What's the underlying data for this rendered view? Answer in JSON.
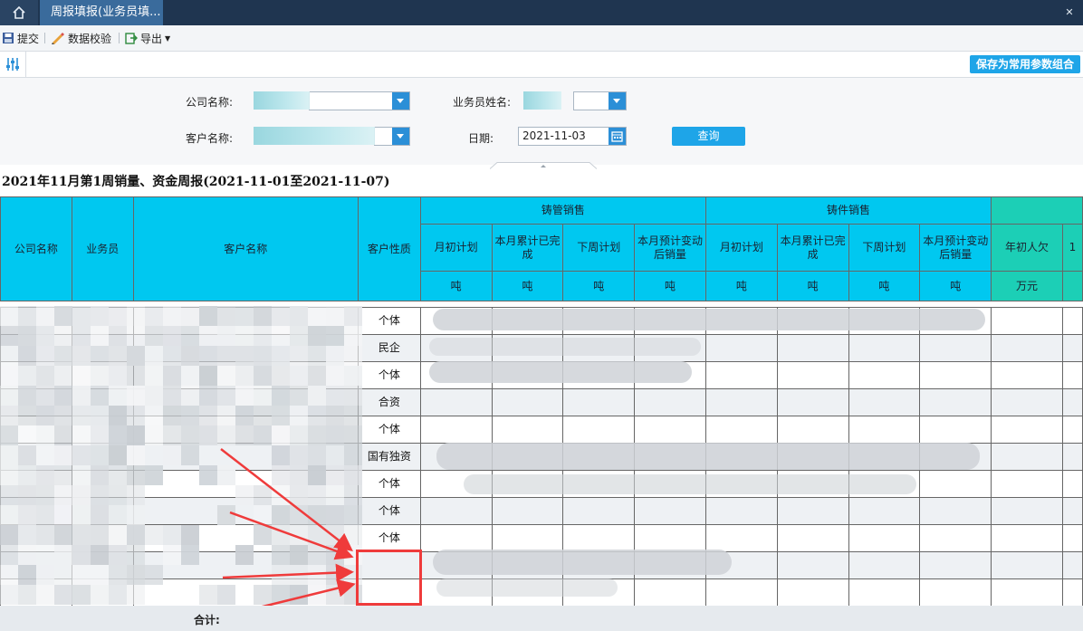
{
  "tabs": {
    "active_label": "周报填报(业务员填..."
  },
  "toolbar": {
    "submit": "提交",
    "validate": "数据校验",
    "export": "导出"
  },
  "actions": {
    "save_params": "保存为常用参数组合",
    "query": "查询"
  },
  "form": {
    "company_label": "公司名称:",
    "salesperson_label": "业务员姓名:",
    "customer_label": "客户名称:",
    "date_label": "日期:",
    "date_value": "2021-11-03"
  },
  "report": {
    "title": "2021年11月第1周销量、资金周报(2021-11-01至2021-11-07)",
    "headers": {
      "company": "公司名称",
      "salesperson": "业务员",
      "customer": "客户名称",
      "nature": "客户性质",
      "group_pipe": "铸管销售",
      "group_casting": "铸件销售",
      "monthly_plan": "月初计划",
      "month_done": "本月累计已完成",
      "next_week": "下周计划",
      "est_sales": "本月预计变动后销量",
      "year_owed": "年初人欠",
      "col_trunc": "1"
    },
    "units": {
      "ton": "吨",
      "wan": "万元"
    },
    "natures": [
      "个体",
      "民企",
      "个体",
      "合资",
      "个体",
      "国有独资",
      "个体",
      "个体",
      "个体",
      "",
      ""
    ],
    "total_label": "合计:"
  },
  "colors": {
    "header_cyan": "#00c8f0",
    "header_teal": "#1ccfb6",
    "accent": "#1ea5e8",
    "highlight_red": "#ef3b3b"
  }
}
